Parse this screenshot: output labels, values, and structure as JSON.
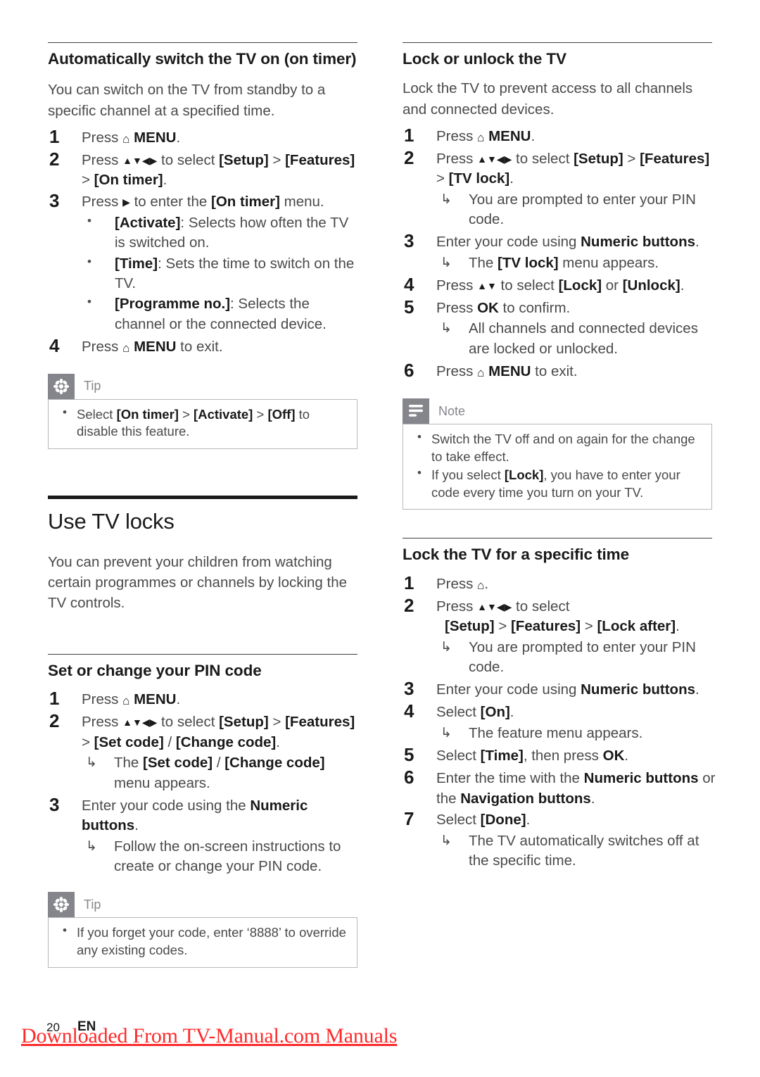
{
  "document": {
    "page_number": "20",
    "language_code": "EN",
    "watermark": "Downloaded From TV-Manual.com Manuals"
  },
  "colors": {
    "chip_grey": "#85858c",
    "callout_border": "#b8b8bd",
    "body_text": "#4a4a4d",
    "heading_text": "#1a1a1a",
    "watermark_red": "#ff2a2a"
  },
  "glyphs": {
    "home": "⌂",
    "nav_all": "▲▼◀▶",
    "nav_up_down": "▲▼",
    "nav_right": "▶",
    "result_arrow": "↳",
    "bullet": "•"
  },
  "left_column": {
    "section_on_timer": {
      "heading": "Automatically switch the TV on (on timer)",
      "intro": "You can switch on the TV from standby to a specific channel at a specified time.",
      "steps": [
        {
          "num": "1",
          "parts": [
            {
              "t": "Press ",
              "s": "n"
            },
            {
              "t": "HOME_ICON",
              "s": "icon-home"
            },
            {
              "t": " MENU",
              "s": "b"
            },
            {
              "t": ".",
              "s": "n"
            }
          ]
        },
        {
          "num": "2",
          "parts": [
            {
              "t": "Press ",
              "s": "n"
            },
            {
              "t": "NAV_ALL",
              "s": "icon-nav"
            },
            {
              "t": " to select ",
              "s": "n"
            },
            {
              "t": "[Setup]",
              "s": "b"
            },
            {
              "t": " > ",
              "s": "n"
            },
            {
              "t": "[Features]",
              "s": "b"
            },
            {
              "t": " > ",
              "s": "n"
            },
            {
              "t": "[On timer]",
              "s": "b"
            },
            {
              "t": ".",
              "s": "n"
            }
          ]
        },
        {
          "num": "3",
          "parts": [
            {
              "t": "Press ",
              "s": "n"
            },
            {
              "t": "NAV_RIGHT",
              "s": "icon-nav"
            },
            {
              "t": " to enter the ",
              "s": "n"
            },
            {
              "t": "[On timer]",
              "s": "b"
            },
            {
              "t": " menu.",
              "s": "n"
            }
          ],
          "bullets": [
            [
              {
                "t": "[Activate]",
                "s": "b"
              },
              {
                "t": ": Selects how often the TV is switched on.",
                "s": "n"
              }
            ],
            [
              {
                "t": "[Time]",
                "s": "b"
              },
              {
                "t": ": Sets the time to switch on the TV.",
                "s": "n"
              }
            ],
            [
              {
                "t": "[Programme no.]",
                "s": "b"
              },
              {
                "t": ": Selects the channel or the connected device.",
                "s": "n"
              }
            ]
          ]
        },
        {
          "num": "4",
          "parts": [
            {
              "t": "Press ",
              "s": "n"
            },
            {
              "t": "HOME_ICON",
              "s": "icon-home"
            },
            {
              "t": " MENU",
              "s": "b"
            },
            {
              "t": " to exit.",
              "s": "n"
            }
          ]
        }
      ],
      "tip": {
        "label": "Tip",
        "icon": "asterisk-icon",
        "items": [
          [
            {
              "t": "Select ",
              "s": "n"
            },
            {
              "t": "[On timer]",
              "s": "b"
            },
            {
              "t": " > ",
              "s": "n"
            },
            {
              "t": "[Activate]",
              "s": "b"
            },
            {
              "t": " > ",
              "s": "n"
            },
            {
              "t": "[Off]",
              "s": "b"
            },
            {
              "t": " to disable this feature.",
              "s": "n"
            }
          ]
        ]
      }
    },
    "chapter_tv_locks": {
      "heading": "Use TV locks",
      "intro": "You can prevent your children from watching certain programmes or channels by locking the TV controls."
    },
    "section_pin_code": {
      "heading": "Set or change your PIN code",
      "steps": [
        {
          "num": "1",
          "parts": [
            {
              "t": "Press ",
              "s": "n"
            },
            {
              "t": "HOME_ICON",
              "s": "icon-home"
            },
            {
              "t": " MENU",
              "s": "b"
            },
            {
              "t": ".",
              "s": "n"
            }
          ]
        },
        {
          "num": "2",
          "parts": [
            {
              "t": "Press ",
              "s": "n"
            },
            {
              "t": "NAV_ALL",
              "s": "icon-nav"
            },
            {
              "t": " to select ",
              "s": "n"
            },
            {
              "t": "[Setup]",
              "s": "b"
            },
            {
              "t": " > ",
              "s": "n"
            },
            {
              "t": "[Features]",
              "s": "b"
            },
            {
              "t": " > ",
              "s": "n"
            },
            {
              "t": "[Set code]",
              "s": "b"
            },
            {
              "t": " / ",
              "s": "n"
            },
            {
              "t": "[Change code]",
              "s": "b"
            },
            {
              "t": ".",
              "s": "n"
            }
          ],
          "results": [
            [
              {
                "t": "The ",
                "s": "n"
              },
              {
                "t": "[Set code]",
                "s": "b"
              },
              {
                "t": " / ",
                "s": "n"
              },
              {
                "t": "[Change code]",
                "s": "b"
              },
              {
                "t": " menu appears.",
                "s": "n"
              }
            ]
          ]
        },
        {
          "num": "3",
          "parts": [
            {
              "t": "Enter your code using the ",
              "s": "n"
            },
            {
              "t": "Numeric buttons",
              "s": "b"
            },
            {
              "t": ".",
              "s": "n"
            }
          ],
          "results": [
            [
              {
                "t": "Follow the on-screen instructions to create or change your PIN code.",
                "s": "n"
              }
            ]
          ]
        }
      ],
      "tip": {
        "label": "Tip",
        "icon": "asterisk-icon",
        "items": [
          [
            {
              "t": "If you forget your code, enter ‘8888’ to override any existing codes.",
              "s": "n"
            }
          ]
        ]
      }
    }
  },
  "right_column": {
    "section_lock_unlock": {
      "heading": "Lock or unlock the TV",
      "intro": "Lock the TV to prevent access to all channels and connected devices.",
      "steps": [
        {
          "num": "1",
          "parts": [
            {
              "t": "Press ",
              "s": "n"
            },
            {
              "t": "HOME_ICON",
              "s": "icon-home"
            },
            {
              "t": " MENU",
              "s": "b"
            },
            {
              "t": ".",
              "s": "n"
            }
          ]
        },
        {
          "num": "2",
          "parts": [
            {
              "t": "Press ",
              "s": "n"
            },
            {
              "t": "NAV_ALL",
              "s": "icon-nav"
            },
            {
              "t": " to select ",
              "s": "n"
            },
            {
              "t": "[Setup]",
              "s": "b"
            },
            {
              "t": " > ",
              "s": "n"
            },
            {
              "t": "[Features]",
              "s": "b"
            },
            {
              "t": " > ",
              "s": "n"
            },
            {
              "t": "[TV lock]",
              "s": "b"
            },
            {
              "t": ".",
              "s": "n"
            }
          ],
          "results": [
            [
              {
                "t": "You are prompted to enter your PIN code.",
                "s": "n"
              }
            ]
          ]
        },
        {
          "num": "3",
          "parts": [
            {
              "t": "Enter your code using ",
              "s": "n"
            },
            {
              "t": "Numeric buttons",
              "s": "b"
            },
            {
              "t": ".",
              "s": "n"
            }
          ],
          "results": [
            [
              {
                "t": "The ",
                "s": "n"
              },
              {
                "t": "[TV lock]",
                "s": "b"
              },
              {
                "t": " menu appears.",
                "s": "n"
              }
            ]
          ]
        },
        {
          "num": "4",
          "parts": [
            {
              "t": "Press ",
              "s": "n"
            },
            {
              "t": "NAV_UP_DOWN",
              "s": "icon-nav"
            },
            {
              "t": " to select ",
              "s": "n"
            },
            {
              "t": "[Lock]",
              "s": "b"
            },
            {
              "t": " or ",
              "s": "n"
            },
            {
              "t": "[Unlock]",
              "s": "b"
            },
            {
              "t": ".",
              "s": "n"
            }
          ]
        },
        {
          "num": "5",
          "parts": [
            {
              "t": "Press ",
              "s": "n"
            },
            {
              "t": "OK",
              "s": "b"
            },
            {
              "t": " to confirm.",
              "s": "n"
            }
          ],
          "results": [
            [
              {
                "t": "All channels and connected devices are locked or unlocked.",
                "s": "n"
              }
            ]
          ]
        },
        {
          "num": "6",
          "parts": [
            {
              "t": "Press ",
              "s": "n"
            },
            {
              "t": "HOME_ICON",
              "s": "icon-home"
            },
            {
              "t": " MENU",
              "s": "b"
            },
            {
              "t": " to exit.",
              "s": "n"
            }
          ]
        }
      ],
      "note": {
        "label": "Note",
        "icon": "lines-icon",
        "items": [
          [
            {
              "t": "Switch the TV off and on again for the change to take effect.",
              "s": "n"
            }
          ],
          [
            {
              "t": "If you select ",
              "s": "n"
            },
            {
              "t": "[Lock]",
              "s": "b"
            },
            {
              "t": ", you have to enter your code every time you turn on your TV.",
              "s": "n"
            }
          ]
        ]
      }
    },
    "section_lock_specific_time": {
      "heading": "Lock the TV for a specific time",
      "steps": [
        {
          "num": "1",
          "parts": [
            {
              "t": "Press ",
              "s": "n"
            },
            {
              "t": "HOME_ICON",
              "s": "icon-home"
            },
            {
              "t": ".",
              "s": "n"
            }
          ]
        },
        {
          "num": "2",
          "parts": [
            {
              "t": "Press ",
              "s": "n"
            },
            {
              "t": "NAV_ALL",
              "s": "icon-nav"
            },
            {
              "t": " to select",
              "s": "n"
            }
          ],
          "continuation": [
            {
              "t": "[Setup]",
              "s": "b"
            },
            {
              "t": " > ",
              "s": "n"
            },
            {
              "t": "[Features]",
              "s": "b"
            },
            {
              "t": " > ",
              "s": "n"
            },
            {
              "t": "[Lock after]",
              "s": "b"
            },
            {
              "t": ".",
              "s": "n"
            }
          ],
          "results": [
            [
              {
                "t": "You are prompted to enter your PIN code.",
                "s": "n"
              }
            ]
          ]
        },
        {
          "num": "3",
          "parts": [
            {
              "t": "Enter your code using ",
              "s": "n"
            },
            {
              "t": "Numeric buttons",
              "s": "b"
            },
            {
              "t": ".",
              "s": "n"
            }
          ]
        },
        {
          "num": "4",
          "parts": [
            {
              "t": "Select ",
              "s": "n"
            },
            {
              "t": "[On]",
              "s": "b"
            },
            {
              "t": ".",
              "s": "n"
            }
          ],
          "results": [
            [
              {
                "t": "The feature menu appears.",
                "s": "n"
              }
            ]
          ]
        },
        {
          "num": "5",
          "parts": [
            {
              "t": "Select ",
              "s": "n"
            },
            {
              "t": "[Time]",
              "s": "b"
            },
            {
              "t": ", then press ",
              "s": "n"
            },
            {
              "t": "OK",
              "s": "b"
            },
            {
              "t": ".",
              "s": "n"
            }
          ]
        },
        {
          "num": "6",
          "parts": [
            {
              "t": "Enter the time with the ",
              "s": "n"
            },
            {
              "t": "Numeric buttons",
              "s": "b"
            },
            {
              "t": " or the ",
              "s": "n"
            },
            {
              "t": "Navigation buttons",
              "s": "b"
            },
            {
              "t": ".",
              "s": "n"
            }
          ]
        },
        {
          "num": "7",
          "parts": [
            {
              "t": "Select ",
              "s": "n"
            },
            {
              "t": "[Done]",
              "s": "b"
            },
            {
              "t": ".",
              "s": "n"
            }
          ],
          "results": [
            [
              {
                "t": "The TV automatically switches off at the specific time.",
                "s": "n"
              }
            ]
          ]
        }
      ]
    }
  }
}
